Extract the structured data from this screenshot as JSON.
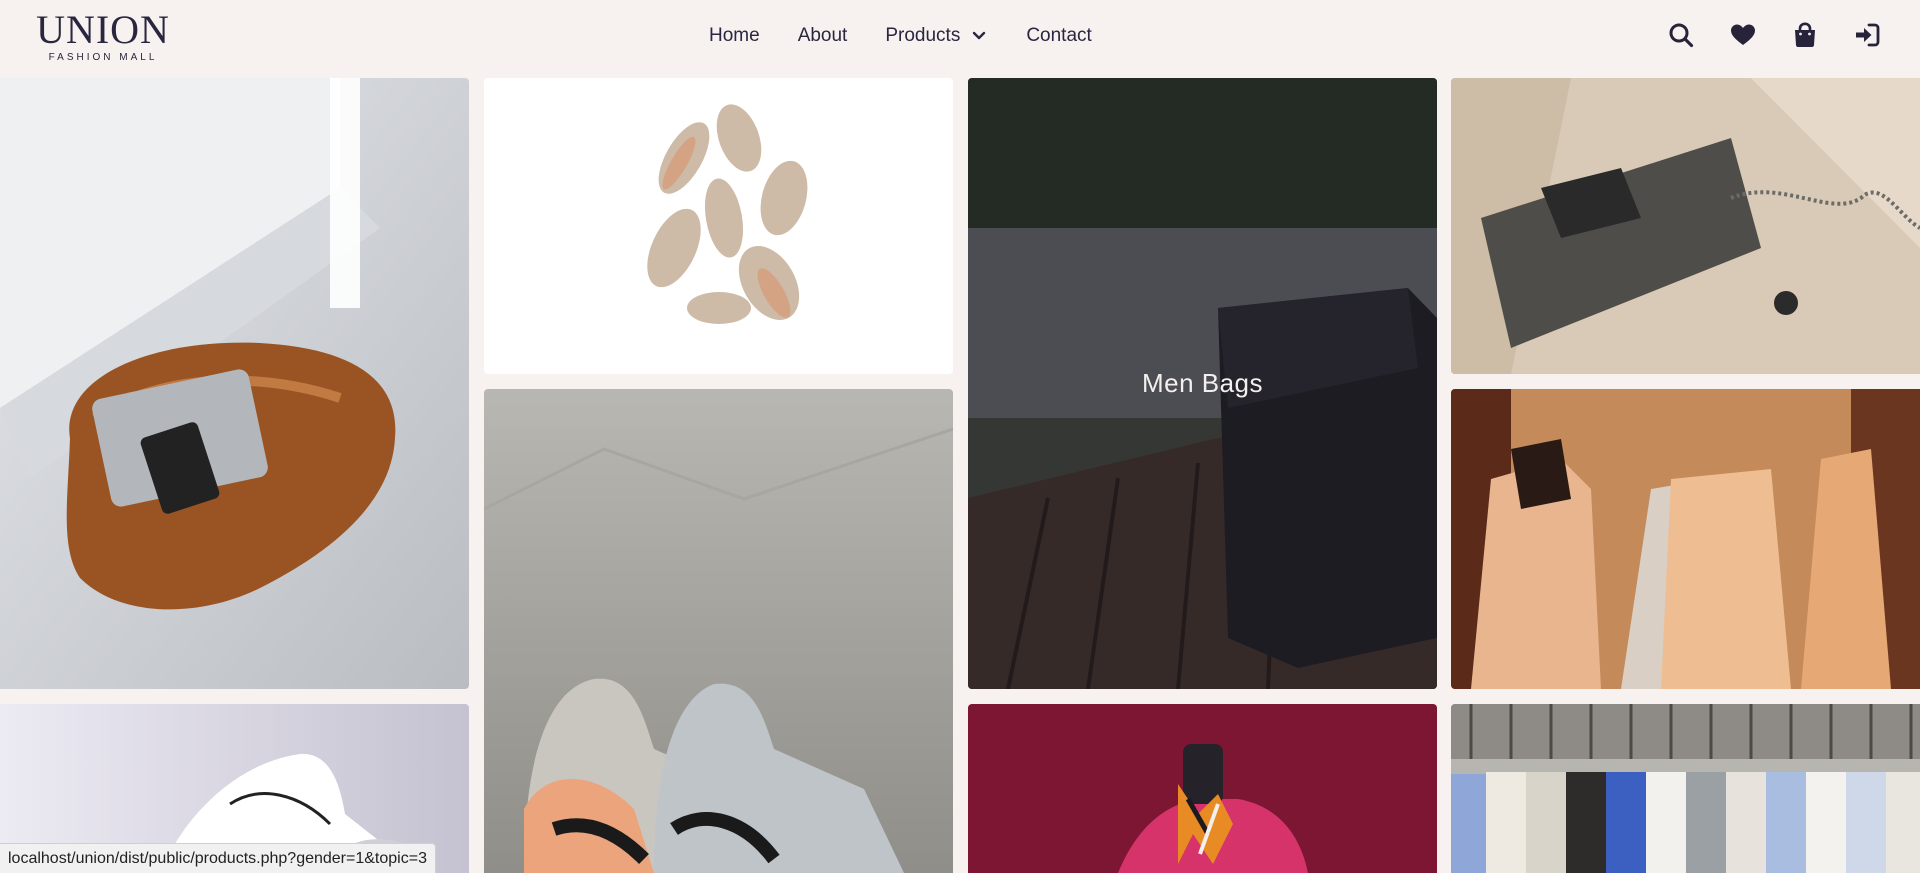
{
  "brand": {
    "name": "UNION",
    "tagline": "FASHION MALL"
  },
  "nav": {
    "home": "Home",
    "about": "About",
    "products": "Products",
    "contact": "Contact"
  },
  "actions": [
    "search-icon",
    "heart-icon",
    "shopping-bag-icon",
    "sign-in-icon"
  ],
  "gallery": {
    "featured_label": "Men Bags",
    "tiles": [
      "leather duffel bag",
      "women heels",
      "sneakers",
      "men bags",
      "designer handbag",
      "dresses",
      "white sneaker",
      "scarf",
      "shirts"
    ]
  },
  "status_bar": {
    "url": "localhost/union/dist/public/products.php?gender=1&topic=3"
  },
  "colors": {
    "background": "#f7f2ef",
    "text": "#2a2640",
    "icon": "#26233a"
  }
}
